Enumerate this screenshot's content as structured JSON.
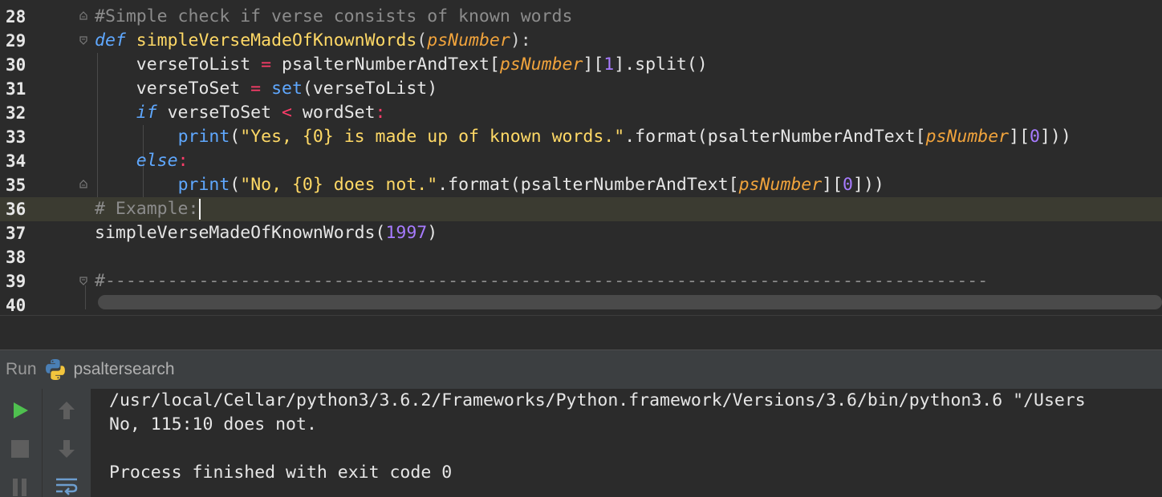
{
  "editor": {
    "line_numbers": [
      "28",
      "29",
      "30",
      "31",
      "32",
      "33",
      "34",
      "35",
      "36",
      "37",
      "38",
      "39",
      "40"
    ],
    "lines": [
      [
        {
          "t": "#Simple check if verse consists of known words",
          "c": "tok-comment"
        }
      ],
      [
        {
          "t": "def",
          "c": "tok-keyword"
        },
        {
          "t": " "
        },
        {
          "t": "simpleVerseMadeOfKnownWords",
          "c": "tok-func"
        },
        {
          "t": "(",
          "c": "tok-punc"
        },
        {
          "t": "psNumber",
          "c": "tok-param"
        },
        {
          "t": "):",
          "c": "tok-punc"
        }
      ],
      [
        {
          "t": "    verseToList "
        },
        {
          "t": "=",
          "c": "tok-op"
        },
        {
          "t": " psalterNumberAndText["
        },
        {
          "t": "psNumber",
          "c": "tok-param"
        },
        {
          "t": "]["
        },
        {
          "t": "1",
          "c": "tok-number"
        },
        {
          "t": "].split()"
        }
      ],
      [
        {
          "t": "    verseToSet "
        },
        {
          "t": "=",
          "c": "tok-op"
        },
        {
          "t": " "
        },
        {
          "t": "set",
          "c": "tok-builtin"
        },
        {
          "t": "(verseToList)"
        }
      ],
      [
        {
          "t": "    "
        },
        {
          "t": "if",
          "c": "tok-keyword"
        },
        {
          "t": " verseToSet "
        },
        {
          "t": "<",
          "c": "tok-op"
        },
        {
          "t": " wordSet"
        },
        {
          "t": ":",
          "c": "tok-op"
        }
      ],
      [
        {
          "t": "        "
        },
        {
          "t": "print",
          "c": "tok-builtin"
        },
        {
          "t": "("
        },
        {
          "t": "\"Yes, {0} is made up of known words.\"",
          "c": "tok-string"
        },
        {
          "t": ".format(psalterNumberAndText["
        },
        {
          "t": "psNumber",
          "c": "tok-param"
        },
        {
          "t": "]["
        },
        {
          "t": "0",
          "c": "tok-number"
        },
        {
          "t": "]))"
        }
      ],
      [
        {
          "t": "    "
        },
        {
          "t": "else",
          "c": "tok-keyword"
        },
        {
          "t": ":",
          "c": "tok-op"
        }
      ],
      [
        {
          "t": "        "
        },
        {
          "t": "print",
          "c": "tok-builtin"
        },
        {
          "t": "("
        },
        {
          "t": "\"No, {0} does not.\"",
          "c": "tok-string"
        },
        {
          "t": ".format(psalterNumberAndText["
        },
        {
          "t": "psNumber",
          "c": "tok-param"
        },
        {
          "t": "]["
        },
        {
          "t": "0",
          "c": "tok-number"
        },
        {
          "t": "]))"
        }
      ],
      [
        {
          "t": "# Example:",
          "c": "tok-comment"
        }
      ],
      [
        {
          "t": "simpleVerseMadeOfKnownWords("
        },
        {
          "t": "1997",
          "c": "tok-number"
        },
        {
          "t": ")"
        }
      ],
      [],
      [
        {
          "t": "#-------------------------------------------------------------------------------------",
          "c": "tok-comment"
        }
      ],
      []
    ],
    "current_line_index": 8
  },
  "run_panel": {
    "label": "Run",
    "config_name": "psaltersearch",
    "console_lines": [
      "/usr/local/Cellar/python3/3.6.2/Frameworks/Python.framework/Versions/3.6/bin/python3.6 \"/Users",
      "No, 115:10 does not.",
      "",
      "Process finished with exit code 0"
    ]
  },
  "colors": {
    "background": "#2b2b2b",
    "panel": "#3c3f41",
    "run_green": "#4fc04f",
    "comment": "#8c8c8c",
    "keyword": "#5fa8ff",
    "function": "#ffd966",
    "param": "#f0a33c",
    "operator": "#ff3d6a",
    "number": "#a77bff"
  },
  "icons": {
    "run": "play-icon",
    "stop": "stop-icon",
    "pause": "pause-icon",
    "scroll_up": "arrow-up-icon",
    "scroll_down": "arrow-down-icon",
    "soft_wrap": "soft-wrap-icon",
    "python": "python-icon"
  }
}
